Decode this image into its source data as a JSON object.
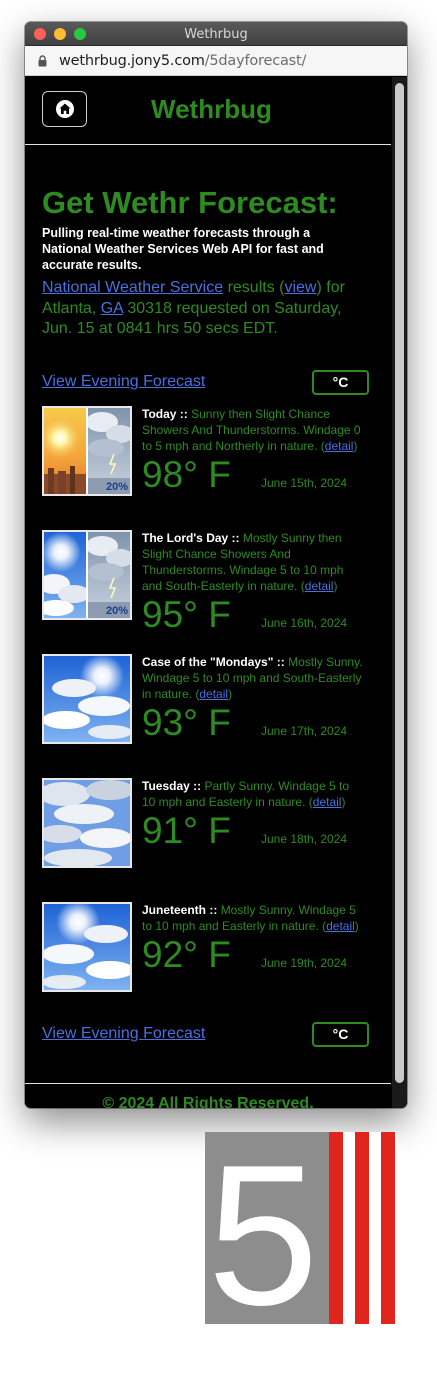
{
  "window": {
    "title": "Wethrbug"
  },
  "address_bar": {
    "domain": "wethrbug.jony5.com",
    "path": "/5dayforecast/"
  },
  "header": {
    "brand": "Wethrbug",
    "home_icon": "home-icon"
  },
  "main": {
    "headline": "Get Wethr Forecast:",
    "intro": "Pulling real-time weather forecasts through a National Weather Services Web API for fast and accurate results.",
    "source": {
      "service_link": "National Weather Service",
      "text_results": " results (",
      "view_link": "view",
      "text_for": ") for Atlanta, ",
      "state_link": "GA",
      "text_rest": " 30318 requested on Saturday, Jun. 15 at 0841 hrs 50 secs EDT."
    },
    "evening_link": "View Evening Forecast",
    "unit_toggle": "°C"
  },
  "forecast": [
    {
      "name": "Today",
      "sep": " :: ",
      "text": "Sunny then Slight Chance Showers And Thunderstorms. Windage 0 to 5 mph and Northerly in nature. (",
      "detail": "detail",
      "close": ")",
      "temp": "98° F",
      "date": "June 15th, 2024",
      "precip": "20%"
    },
    {
      "name": "The Lord's Day",
      "sep": " :: ",
      "text": "Mostly Sunny then Slight Chance Showers And Thunderstorms. Windage 5 to 10 mph and South-Easterly in nature. (",
      "detail": "detail",
      "close": ")",
      "temp": "95° F",
      "date": "June 16th, 2024",
      "precip": "20%"
    },
    {
      "name": "Case of the \"Mondays\"",
      "sep": " :: ",
      "text": "Mostly Sunny. Windage 5 to 10 mph and South-Easterly in nature. (",
      "detail": "detail",
      "close": ")",
      "temp": "93° F",
      "date": "June 17th, 2024"
    },
    {
      "name": "Tuesday",
      "sep": " :: ",
      "text": "Partly Sunny. Windage 5 to 10 mph and Easterly in nature. (",
      "detail": "detail",
      "close": ")",
      "temp": "91° F",
      "date": "June 18th, 2024"
    },
    {
      "name": "Juneteenth",
      "sep": " :: ",
      "text": "Mostly Sunny. Windage 5 to 10 mph and Easterly in nature. (",
      "detail": "detail",
      "close": ")",
      "temp": "92° F",
      "date": "June 19th, 2024"
    }
  ],
  "footer": {
    "text": "© 2024 All Rights Reserved."
  },
  "logo": {
    "digit": "5"
  },
  "colors": {
    "accent_green": "#2e8b22",
    "link_blue": "#4a6fe0",
    "logo_red": "#e0261c",
    "logo_gray": "#8d8d8d"
  }
}
